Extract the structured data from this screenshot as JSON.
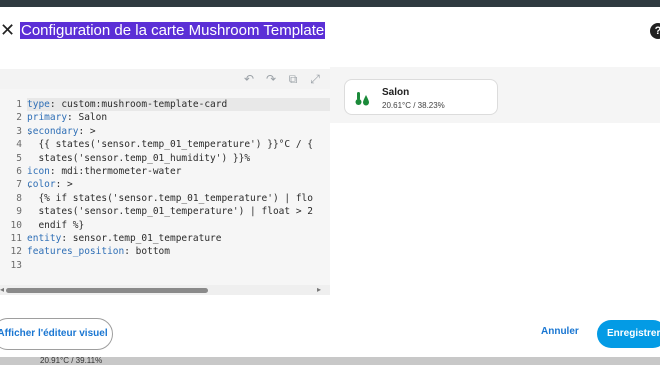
{
  "dialog": {
    "title": "Configuration de la carte Mushroom Template"
  },
  "editor": {
    "lines": [
      {
        "n": "1",
        "fold": false,
        "active": true,
        "key": "type",
        "rest": ": custom:mushroom-template-card"
      },
      {
        "n": "2",
        "fold": false,
        "active": false,
        "key": "primary",
        "rest": ": Salon"
      },
      {
        "n": "3",
        "fold": true,
        "active": false,
        "key": "secondary",
        "rest": ": >"
      },
      {
        "n": "4",
        "fold": false,
        "active": false,
        "key": "",
        "rest": "  {{ states('sensor.temp_01_temperature') }}°C / {"
      },
      {
        "n": "5",
        "fold": false,
        "active": false,
        "key": "",
        "rest": "  states('sensor.temp_01_humidity') }}%"
      },
      {
        "n": "6",
        "fold": false,
        "active": false,
        "key": "icon",
        "rest": ": mdi:thermometer-water"
      },
      {
        "n": "7",
        "fold": true,
        "active": false,
        "key": "color",
        "rest": ": >"
      },
      {
        "n": "8",
        "fold": false,
        "active": false,
        "key": "",
        "rest": "  {% if states('sensor.temp_01_temperature') | flo"
      },
      {
        "n": "9",
        "fold": false,
        "active": false,
        "key": "",
        "rest": "  states('sensor.temp_01_temperature') | float > 2"
      },
      {
        "n": "10",
        "fold": false,
        "active": false,
        "key": "",
        "rest": "  endif %}"
      },
      {
        "n": "11",
        "fold": false,
        "active": false,
        "key": "entity",
        "rest": ": sensor.temp_01_temperature"
      },
      {
        "n": "12",
        "fold": false,
        "active": false,
        "key": "features_position",
        "rest": ": bottom"
      },
      {
        "n": "13",
        "fold": false,
        "active": false,
        "key": "",
        "rest": ""
      }
    ]
  },
  "preview": {
    "primary": "Salon",
    "secondary": "20.61°C / 38.23%",
    "icon": "thermometer-water-icon",
    "icon_color": "#1b8a3a"
  },
  "footer": {
    "visual_editor_label": "Afficher l'éditeur visuel",
    "cancel_label": "Annuler",
    "save_label": "Enregistrer"
  },
  "background_peek": {
    "text": "20.91°C / 39.11%"
  },
  "colors": {
    "primary": "#1976d2",
    "save_button": "#039be5",
    "title_highlight": "#5b2fd6"
  }
}
